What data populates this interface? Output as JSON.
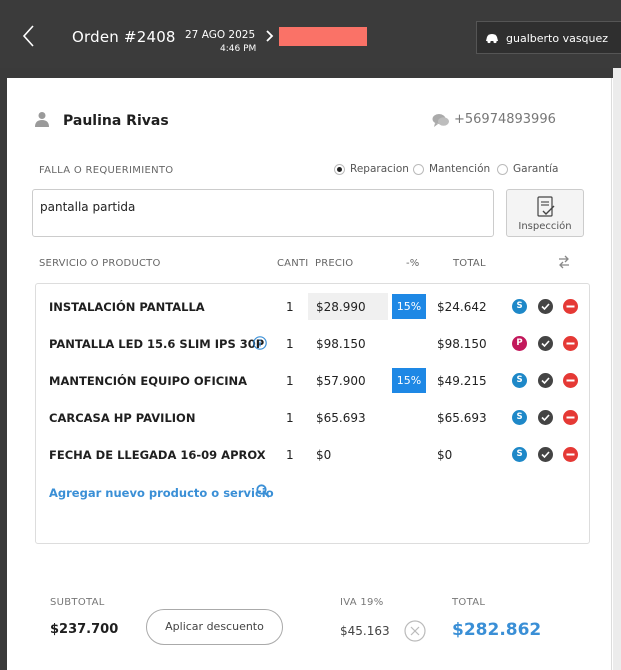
{
  "header": {
    "order_title": "Orden #2408",
    "date": "27 AGO 2025",
    "time": "4:46 PM",
    "status_color": "#fa7267",
    "user_name": "gualberto vasquez",
    "back_icon": "chevron-left-icon",
    "user_icon": "car-icon"
  },
  "client": {
    "name": "Paulina Rivas",
    "phone": "+56974893996"
  },
  "request": {
    "label": "FALLA O REQUERIMIENTO",
    "value": "pantalla partida",
    "options": [
      {
        "label": "Reparacion",
        "selected": true
      },
      {
        "label": "Mantención",
        "selected": false
      },
      {
        "label": "Garantía",
        "selected": false
      }
    ],
    "inspection_label": "Inspección"
  },
  "table": {
    "headers": {
      "product": "SERVICIO O PRODUCTO",
      "qty": "CANTI",
      "price": "PRECIO",
      "discount": "-%",
      "total": "TOTAL"
    },
    "rows": [
      {
        "name": "INSTALACIÓN PANTALLA",
        "qty": "1",
        "price": "$28.990",
        "discount": "15%",
        "total": "$24.642",
        "badge": "S",
        "badge_color": "#1e88c8"
      },
      {
        "name": "PANTALLA LED 15.6 SLIM IPS 30P",
        "qty": "1",
        "price": "$98.150",
        "discount": "",
        "total": "$98.150",
        "badge": "P",
        "badge_color": "#c2185b"
      },
      {
        "name": "MANTENCIÓN EQUIPO OFICINA",
        "qty": "1",
        "price": "$57.900",
        "discount": "15%",
        "total": "$49.215",
        "badge": "S",
        "badge_color": "#1e88c8"
      },
      {
        "name": "CARCASA HP PAVILION",
        "qty": "1",
        "price": "$65.693",
        "discount": "",
        "total": "$65.693",
        "badge": "S",
        "badge_color": "#1e88c8"
      },
      {
        "name": "FECHA DE LLEGADA 16-09 APROX",
        "qty": "1",
        "price": "$0",
        "discount": "",
        "total": "$0",
        "badge": "S",
        "badge_color": "#1e88c8"
      }
    ],
    "add_link": "Agregar nuevo producto o servicio"
  },
  "footer": {
    "subtotal_label": "SUBTOTAL",
    "subtotal": "$237.700",
    "discount_button": "Aplicar descuento",
    "iva_label": "IVA 19%",
    "iva": "$45.163",
    "total_label": "TOTAL",
    "total": "$282.862",
    "accent_color": "#3a8fd6"
  }
}
